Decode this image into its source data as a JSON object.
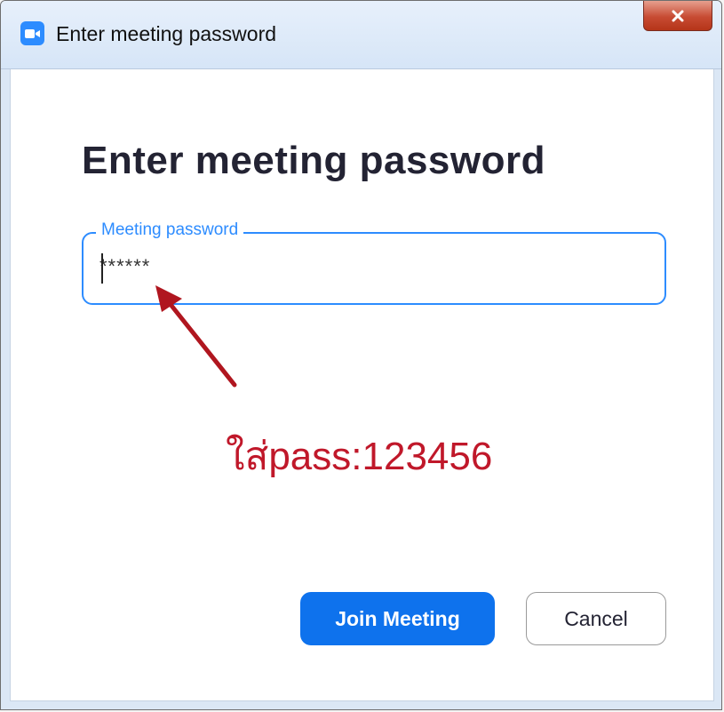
{
  "window": {
    "title": "Enter meeting password",
    "close_icon": "close-icon",
    "app_icon": "zoom-video-icon"
  },
  "dialog": {
    "heading": "Enter meeting password",
    "password_field": {
      "label": "Meeting password",
      "value": "******"
    },
    "annotation": {
      "text": "ใส่pass:123456",
      "arrow_icon": "red-arrow-icon",
      "color": "#c0182a"
    },
    "buttons": {
      "join_label": "Join Meeting",
      "cancel_label": "Cancel"
    }
  },
  "colors": {
    "accent": "#2d8cff",
    "primary_button": "#0e72ed",
    "close_button": "#c74b33"
  }
}
